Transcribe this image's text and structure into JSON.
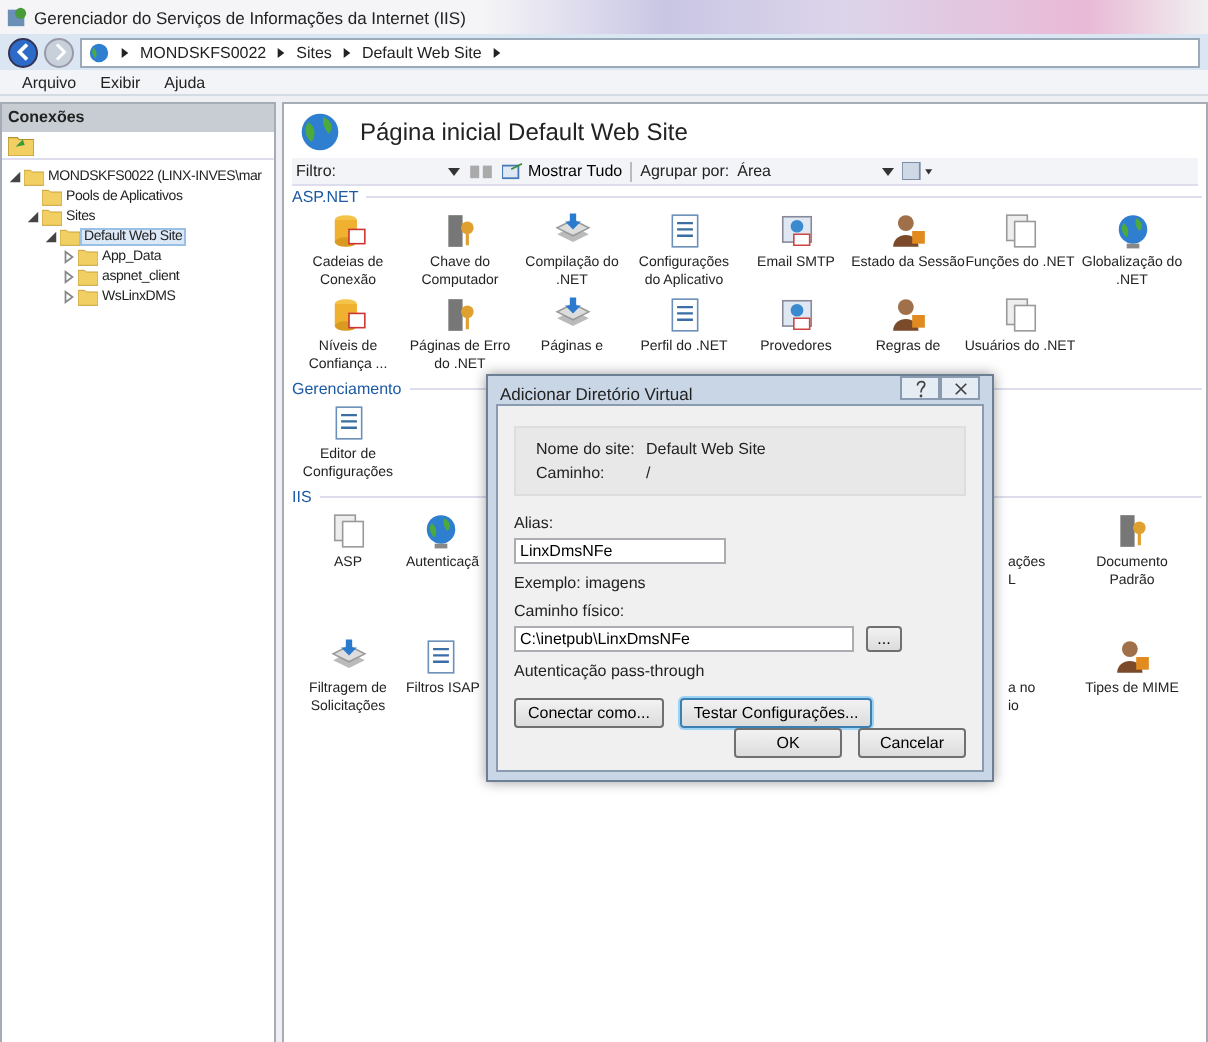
{
  "window": {
    "title": "Gerenciador do Serviços de Informações da Internet (IIS)"
  },
  "address_bar": {
    "segments": [
      "MONDSKFS0022",
      "Sites",
      "Default Web Site"
    ]
  },
  "menu": [
    "Arquivo",
    "Exibir",
    "Ajuda"
  ],
  "connections": {
    "title": "Conexões",
    "tree": [
      {
        "label": "MONDSKFS0022 (LINX-INVES\\mar",
        "expanded": true,
        "selected": false,
        "children": [
          {
            "label": "Pools de Aplicativos",
            "selected": false
          },
          {
            "label": "Sites",
            "expanded": true,
            "selected": false,
            "children": [
              {
                "label": "Default Web Site",
                "expanded": true,
                "selected": true,
                "children": [
                  {
                    "label": "App_Data",
                    "expanded": false,
                    "selected": false
                  },
                  {
                    "label": "aspnet_client",
                    "expanded": false,
                    "selected": false
                  },
                  {
                    "label": "WsLinxDMS",
                    "expanded": false,
                    "selected": false
                  }
                ]
              }
            ]
          }
        ]
      }
    ]
  },
  "main": {
    "title": "Página inicial Default Web Site",
    "toolbar": {
      "filter_label": "Filtro:",
      "show_all": "Mostrar Tudo",
      "group_label": "Agrupar por:",
      "group_value": "Área"
    },
    "sections": [
      {
        "title": "ASP.NET",
        "items": [
          {
            "label": "Cadeias de\nConexão"
          },
          {
            "label": "Chave do\nComputador"
          },
          {
            "label": "Compilação do\n.NET"
          },
          {
            "label": "Configurações\ndo Aplicativo"
          },
          {
            "label": "Email SMTP"
          },
          {
            "label": "Estado da Sessão"
          },
          {
            "label": "Funções do .NET"
          },
          {
            "label": "Globalização do\n.NET"
          },
          {
            "label": "Níveis de\nConfiança ..."
          },
          {
            "label": "Páginas de Erro\ndo .NET"
          },
          {
            "label": "Páginas e"
          },
          {
            "label": "Perfil do .NET"
          },
          {
            "label": "Provedores"
          },
          {
            "label": "Regras de"
          },
          {
            "label": "Usuários do .NET"
          }
        ]
      },
      {
        "title": "Gerenciamento",
        "items": [
          {
            "label": "Editor de\nConfigurações"
          }
        ]
      },
      {
        "title": "IIS",
        "items": [
          {
            "label": "ASP"
          },
          {
            "label": "Autenticaçã",
            "kind": "cut_right"
          },
          {
            "label": "ações\nL",
            "kind": "cut_left"
          },
          {
            "label": "Documento\nPadrão"
          },
          {
            "label": "Filtragem de\nSolicitações"
          },
          {
            "label": "Filtros ISAP",
            "kind": "cut_right"
          },
          {
            "label": "a no\nio",
            "kind": "cut_left"
          },
          {
            "label": "Tipes de MIME"
          }
        ]
      }
    ]
  },
  "dialog": {
    "title": "Adicionar Diretório Virtual",
    "info": [
      {
        "label": "Nome do site:",
        "value": "Default Web Site"
      },
      {
        "label": "Caminho:",
        "value": "/"
      }
    ],
    "alias_label": "Alias:",
    "alias_value": "LinxDmsNFe",
    "example": "Exemplo: imagens",
    "path_label": "Caminho físico:",
    "path_value": "C:\\inetpub\\LinxDmsNFe",
    "browse": "...",
    "auth": "Autenticação pass-through",
    "buttons": [
      {
        "label": "Conectar como...",
        "focused": false
      },
      {
        "label": "Testar Configurações...",
        "focused": true
      }
    ],
    "ok": "OK",
    "cancel": "Cancelar"
  }
}
